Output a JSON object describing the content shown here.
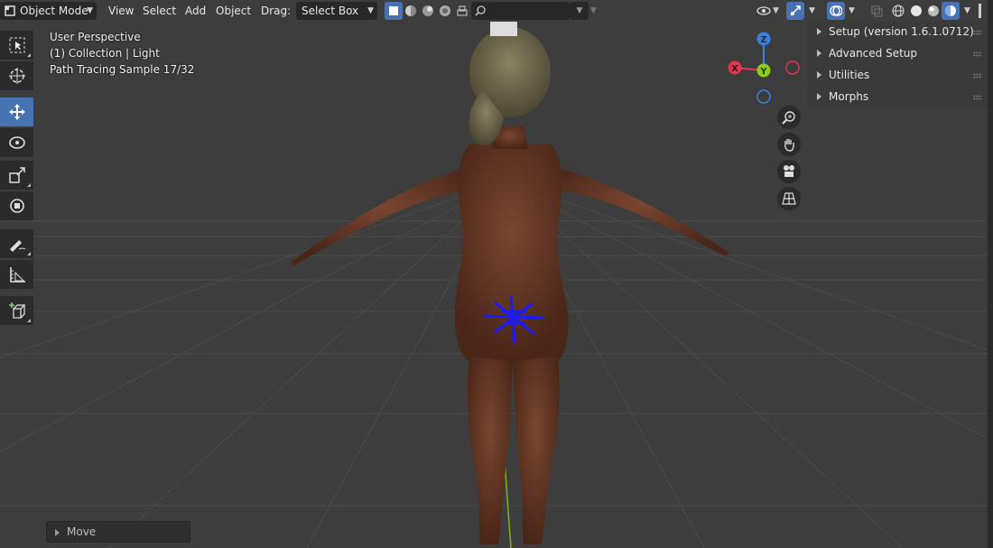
{
  "header": {
    "mode_label": "Object Mode",
    "menu_view": "View",
    "menu_select": "Select",
    "menu_add": "Add",
    "menu_object": "Object",
    "drag_label": "Drag:",
    "drag_value": "Select Box"
  },
  "viewport_info": {
    "view_name": "User Perspective",
    "collection": "(1) Collection | Light",
    "render_status": "Path Tracing Sample 17/32"
  },
  "gizmo": {
    "z": "Z",
    "y": "Y",
    "x": "X"
  },
  "toolbar": {
    "tools": [
      "select-box",
      "cursor",
      "move",
      "rotate",
      "scale",
      "transform",
      "annotate",
      "measure",
      "add-cube"
    ],
    "active_tool": "move"
  },
  "sidebar": {
    "panels": [
      {
        "label": "Setup (version 1.6.1.0712)"
      },
      {
        "label": "Advanced Setup"
      },
      {
        "label": "Utilities"
      },
      {
        "label": "Morphs"
      }
    ]
  },
  "last_operator": {
    "label": "Move"
  },
  "colors": {
    "accent": "#4772b3",
    "viewport_bg": "#3d3d3d",
    "axis_x": "#e0364f",
    "axis_y": "#8ccc1a",
    "axis_z": "#3a80e0",
    "gizmo_marker": "#1a1aff"
  }
}
